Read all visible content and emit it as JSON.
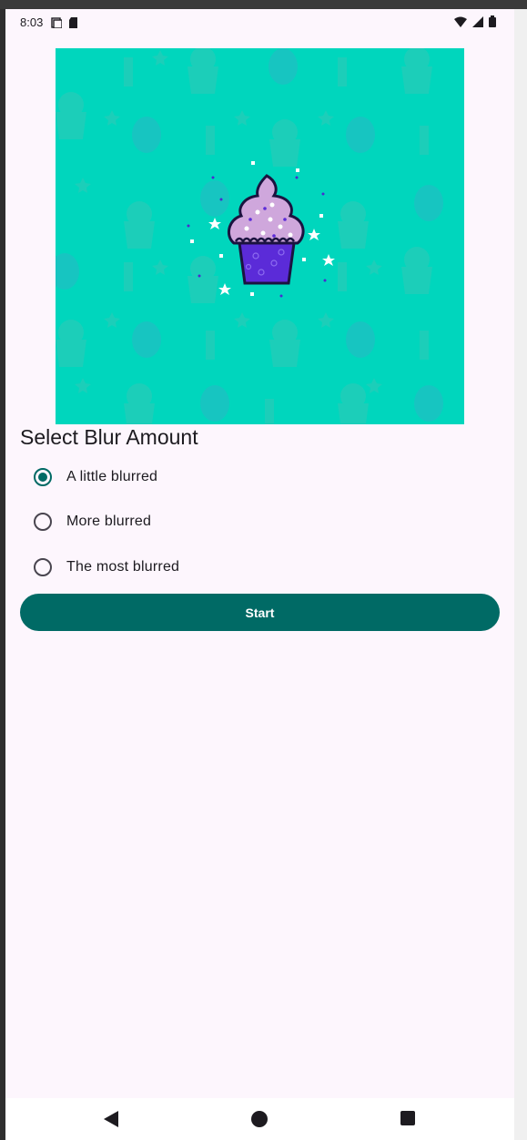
{
  "status": {
    "time": "8:03"
  },
  "icons": {
    "status_left": [
      "screen-icon",
      "sd-card-icon"
    ],
    "status_right": [
      "wifi-icon",
      "signal-icon",
      "battery-icon"
    ],
    "nav": [
      "back-icon",
      "home-icon",
      "recents-icon"
    ]
  },
  "screen": {
    "title": "Select Blur Amount",
    "options": [
      {
        "label": "A little blurred",
        "selected": true
      },
      {
        "label": "More blurred",
        "selected": false
      },
      {
        "label": "The most blurred",
        "selected": false
      }
    ],
    "start_label": "Start"
  },
  "colors": {
    "accent": "#006a65",
    "background": "#fdf6fd",
    "hero_bg": "#00d6bd",
    "cupcake_frosting": "#cfa7dc",
    "cupcake_cup": "#5b2bd8"
  }
}
